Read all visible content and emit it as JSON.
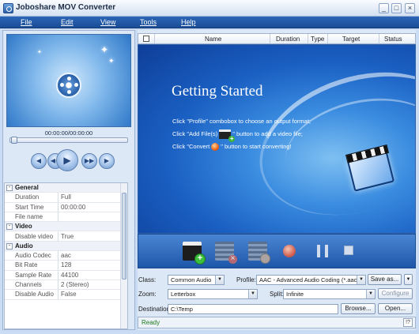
{
  "window": {
    "title": "Joboshare MOV Converter",
    "minimize": "_",
    "maximize": "□",
    "close": "×"
  },
  "menu": {
    "items": [
      "File",
      "Edit",
      "View",
      "Tools",
      "Help"
    ]
  },
  "player": {
    "timecode": "00:00:00/00:00:00",
    "buttons": {
      "prev": "◀",
      "rewind": "◀◀",
      "play": "▶",
      "forward": "▶▶",
      "next": "▶"
    }
  },
  "properties": {
    "rows": [
      {
        "type": "category",
        "key": "General",
        "toggle": "-"
      },
      {
        "type": "item",
        "key": "Duration",
        "value": "Full"
      },
      {
        "type": "item",
        "key": "Start Time",
        "value": "00:00:00"
      },
      {
        "type": "item",
        "key": "File name",
        "value": ""
      },
      {
        "type": "category",
        "key": "Video",
        "toggle": "-"
      },
      {
        "type": "item",
        "key": "Disable video",
        "value": "True"
      },
      {
        "type": "category",
        "key": "Audio",
        "toggle": "-"
      },
      {
        "type": "item",
        "key": "Audio Codec",
        "value": "aac"
      },
      {
        "type": "item",
        "key": "Bit Rate",
        "value": "128"
      },
      {
        "type": "item",
        "key": "Sample Rate",
        "value": "44100"
      },
      {
        "type": "item",
        "key": "Channels",
        "value": "2 (Stereo)"
      },
      {
        "type": "item",
        "key": "Disable Audio",
        "value": "False"
      }
    ]
  },
  "list": {
    "columns": [
      "Name",
      "Duration",
      "Type",
      "Target",
      "Status"
    ]
  },
  "getting_started": {
    "title": "Getting Started",
    "line1": "Click \"Profile\" combobox to choose an output format;",
    "line2_a": "Click \"Add File(s)",
    "line2_b": "\" button to add a video file;",
    "line3_a": "Click \"Convert",
    "line3_b": "\" button to start converting!"
  },
  "settings": {
    "class_label": "Class:",
    "class_value": "Common Audio",
    "profile_label": "Profile:",
    "profile_value": "AAC - Advanced Audio Coding  (*.aac)",
    "save_as": "Save as...",
    "zoom_label": "Zoom:",
    "zoom_value": "Letterbox",
    "split_label": "Split:",
    "split_value": "Infinite",
    "configure": "Configure",
    "destination_label": "Destination:",
    "destination_value": "C:\\Temp",
    "browse": "Browse...",
    "open": "Open..."
  },
  "status": {
    "text": "Ready",
    "help": "!?"
  },
  "colors": {
    "menubar": "#1f569f",
    "stage": "#1a5fc2",
    "accent": "#3bb33b"
  }
}
